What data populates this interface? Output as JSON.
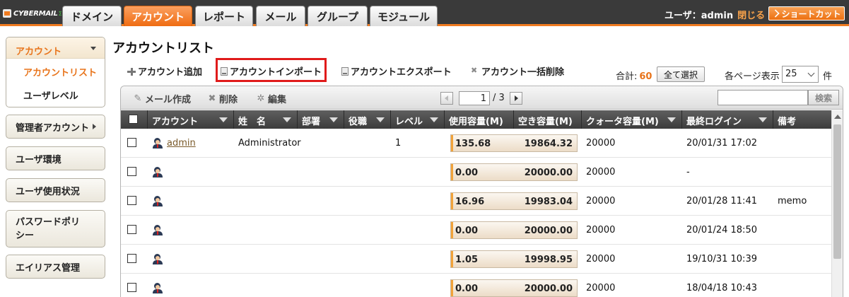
{
  "logo": {
    "text": "CYBERMAIL",
    "sup": "Σ"
  },
  "main_tabs": [
    {
      "label": "ドメイン",
      "active": false
    },
    {
      "label": "アカウント",
      "active": true
    },
    {
      "label": "レポート",
      "active": false
    },
    {
      "label": "メール",
      "active": false
    },
    {
      "label": "グループ",
      "active": false
    },
    {
      "label": "モジュール",
      "active": false
    }
  ],
  "user": {
    "label": "ユーザ：admin",
    "logout": "閉じる",
    "shortcut": "ショートカット"
  },
  "sidebar": {
    "account": {
      "title": "アカウント",
      "items": [
        "アカウントリスト",
        "ユーザレベル"
      ]
    },
    "items": [
      "管理者アカウント",
      "ユーザ環境",
      "ユーザ使用状況",
      "パスワードポリシー",
      "エイリアス管理"
    ]
  },
  "page": {
    "title": "アカウントリスト"
  },
  "actions": {
    "add": "アカウント追加",
    "import": "アカウントインポート",
    "export": "アカウントエクスポート",
    "bulk_delete": "アカウント一括削除"
  },
  "summary": {
    "total_label": "合計:",
    "total": "60",
    "select_all": "全て選択",
    "per_page_label": "各ページ表示",
    "per_page": "25",
    "per_page_unit": "件"
  },
  "toolbar": {
    "compose": "メール作成",
    "delete": "削除",
    "edit": "編集",
    "page": "1",
    "page_total": "/ 3",
    "search": "検索"
  },
  "columns": [
    "アカウント",
    "姓　名",
    "部署",
    "役職",
    "レベル",
    "使用容量(M)",
    "空き容量(M)",
    "クォータ容量(M)",
    "最終ログイン",
    "備考"
  ],
  "rows": [
    {
      "account": "admin",
      "name": "Administrator",
      "level": "1",
      "used": "135.68",
      "free": "19864.32",
      "quota": "20000",
      "used_fraction": 0.0068,
      "last_login": "20/01/31 17:02",
      "memo": ""
    },
    {
      "account": "",
      "name": "",
      "level": "",
      "used": "0.00",
      "free": "20000.00",
      "quota": "20000",
      "used_fraction": 0,
      "last_login": "-",
      "memo": ""
    },
    {
      "account": "",
      "name": "",
      "level": "",
      "used": "16.96",
      "free": "19983.04",
      "quota": "20000",
      "used_fraction": 0.0008,
      "last_login": "20/01/28 11:41",
      "memo": "memo"
    },
    {
      "account": "",
      "name": "",
      "level": "",
      "used": "0.00",
      "free": "20000.00",
      "quota": "20000",
      "used_fraction": 0,
      "last_login": "20/01/24 18:50",
      "memo": ""
    },
    {
      "account": "",
      "name": "",
      "level": "",
      "used": "1.05",
      "free": "19998.95",
      "quota": "20000",
      "used_fraction": 0.0001,
      "last_login": "19/10/31 10:39",
      "memo": ""
    },
    {
      "account": "",
      "name": "",
      "level": "",
      "used": "0.00",
      "free": "20000.00",
      "quota": "20000",
      "used_fraction": 0,
      "last_login": "18/04/18 10:43",
      "memo": ""
    }
  ]
}
